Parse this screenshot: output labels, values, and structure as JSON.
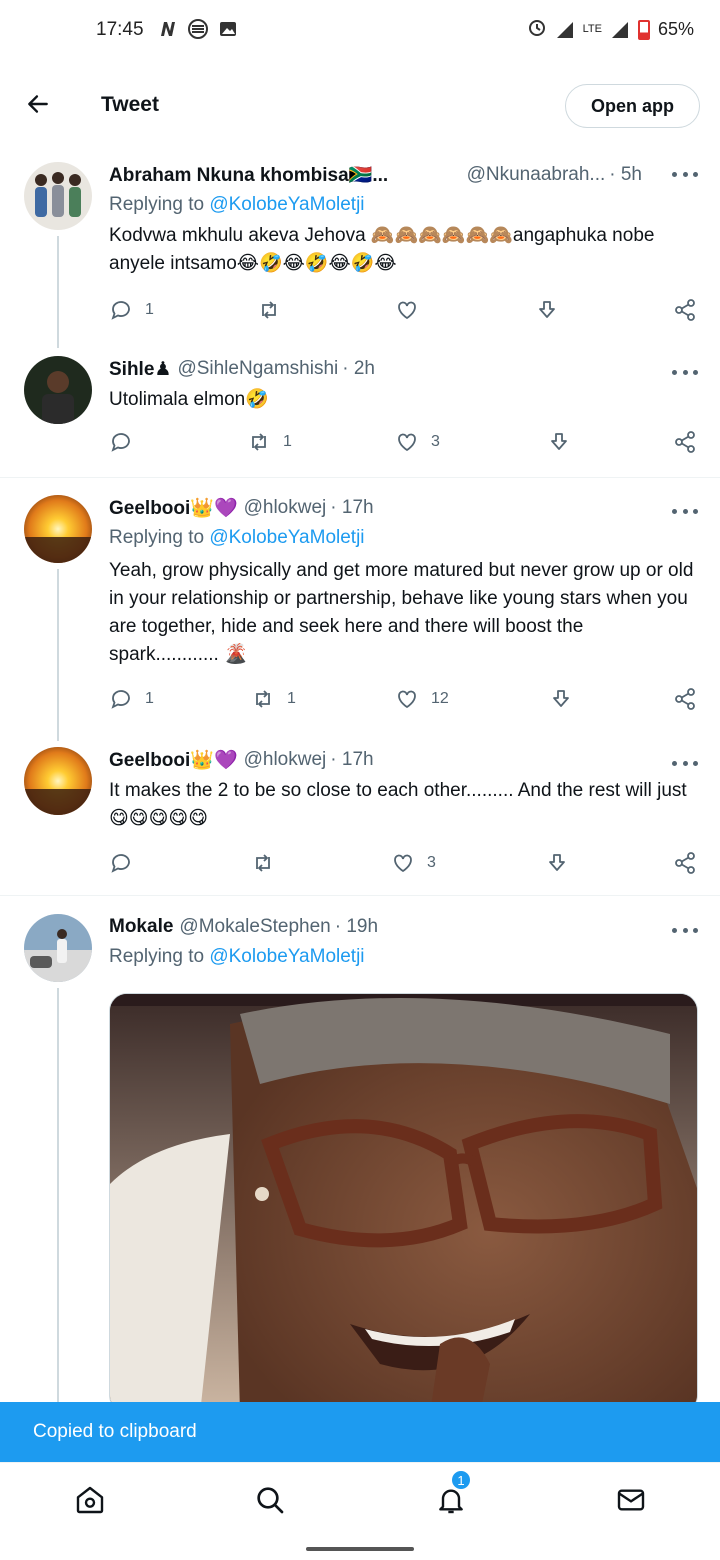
{
  "status_bar": {
    "time": "17:45",
    "network": "LTE",
    "battery": "65%"
  },
  "header": {
    "title": "Tweet",
    "open_app": "Open app"
  },
  "tweets": [
    {
      "name": "Abraham Nkuna khombisa🇿🇦...",
      "handle": "@Nkunaabrah...",
      "time": "· 5h",
      "replying_prefix": "Replying to",
      "replying_to": "@KolobeYaMoletji",
      "text": "Kodvwa mkhulu akeva Jehova 🙈🙈🙈🙈🙈🙈angaphuka nobe anyele intsamo😂🤣😂🤣😂🤣😂",
      "reply_count": "1",
      "retweet_count": "",
      "like_count": ""
    },
    {
      "name": "Sihle♟",
      "handle": "@SihleNgamshishi",
      "time": "· 2h",
      "text": "Utolimala elmon🤣",
      "reply_count": "",
      "retweet_count": "1",
      "like_count": "3"
    },
    {
      "name": "Geelbooi👑💜",
      "handle": "@hlokwej",
      "time": "· 17h",
      "replying_prefix": "Replying to",
      "replying_to": "@KolobeYaMoletji",
      "text": "Yeah, grow physically and get more matured but never grow up or old in your relationship or partnership, behave like young stars when you are together, hide and seek here and there will boost the spark............ 🌋",
      "reply_count": "1",
      "retweet_count": "1",
      "like_count": "12"
    },
    {
      "name": "Geelbooi👑💜",
      "handle": "@hlokwej",
      "time": "· 17h",
      "text": "It makes the 2 to be so close to each other......... And the rest will just 😋😋😋😋😋",
      "reply_count": "",
      "retweet_count": "",
      "like_count": "3"
    },
    {
      "name": "Mokale",
      "handle": "@MokaleStephen",
      "time": "· 19h",
      "replying_prefix": "Replying to",
      "replying_to": "@KolobeYaMoletji"
    }
  ],
  "toast": "Copied to clipboard",
  "bottom_nav": {
    "notification_badge": "1"
  },
  "icons": [
    "back-arrow-icon",
    "more-icon",
    "reply-icon",
    "retweet-icon",
    "like-icon",
    "download-icon",
    "share-icon",
    "home-icon",
    "search-icon",
    "bell-icon",
    "mail-icon"
  ],
  "colors": {
    "accent": "#1d9bf0",
    "text": "#0f1419",
    "muted": "#536471"
  }
}
